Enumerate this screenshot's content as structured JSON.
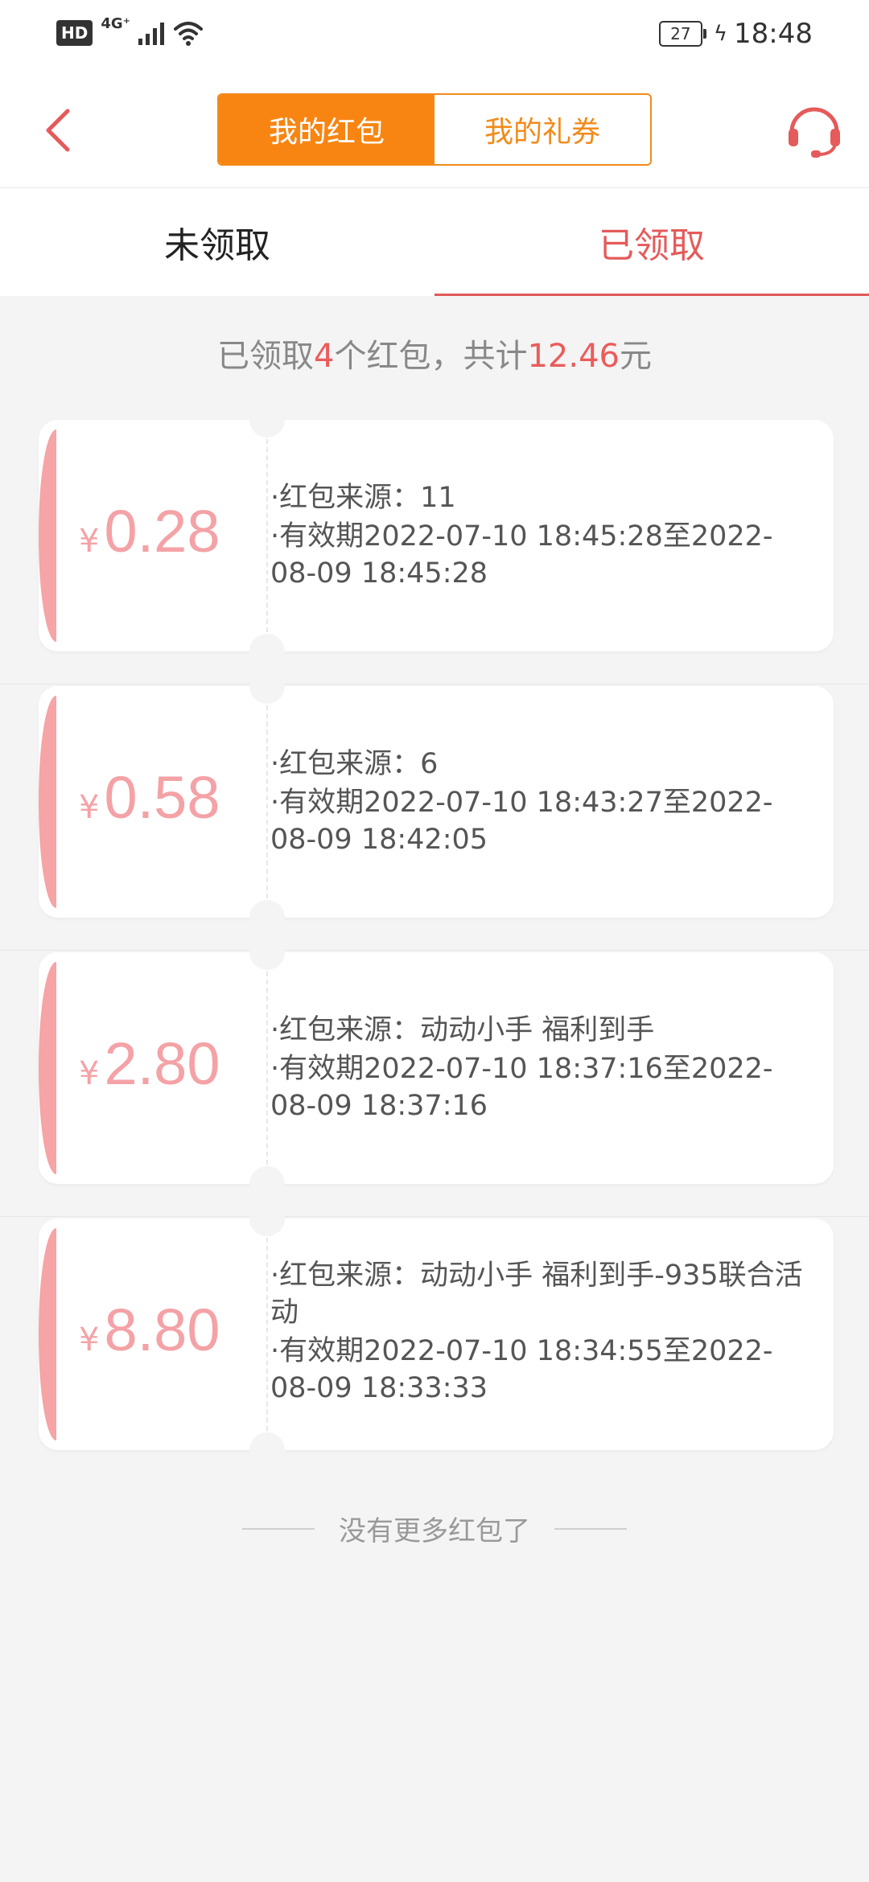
{
  "status_bar": {
    "hd": "HD",
    "network": "4G⁺",
    "battery": "27",
    "time": "18:48"
  },
  "header": {
    "tab_red_packets": "我的红包",
    "tab_coupons": "我的礼券",
    "back_icon": "chevron-left-icon",
    "service_icon": "headset-icon"
  },
  "subtabs": {
    "unclaimed": "未领取",
    "claimed": "已领取"
  },
  "summary": {
    "prefix": "已领取",
    "count": "4",
    "middle": "个红包，共计",
    "total": "12.46",
    "suffix": "元"
  },
  "packets": [
    {
      "currency": "¥",
      "amount": "0.28",
      "source": "·红包来源：11",
      "validity": "·有效期2022-07-10 18:45:28至2022-08-09 18:45:28"
    },
    {
      "currency": "¥",
      "amount": "0.58",
      "source": "·红包来源：6",
      "validity": "·有效期2022-07-10 18:43:27至2022-08-09 18:42:05"
    },
    {
      "currency": "¥",
      "amount": "2.80",
      "source": "·红包来源：动动小手 福利到手",
      "validity": "·有效期2022-07-10 18:37:16至2022-08-09 18:37:16"
    },
    {
      "currency": "¥",
      "amount": "8.80",
      "source": "·红包来源：动动小手 福利到手-935联合活动",
      "validity": "·有效期2022-07-10 18:34:55至2022-08-09 18:33:33"
    }
  ],
  "end_note": "没有更多红包了",
  "colors": {
    "accent_orange": "#f88512",
    "accent_red": "#e55a5a",
    "amount_pink": "#f4a2a6"
  }
}
